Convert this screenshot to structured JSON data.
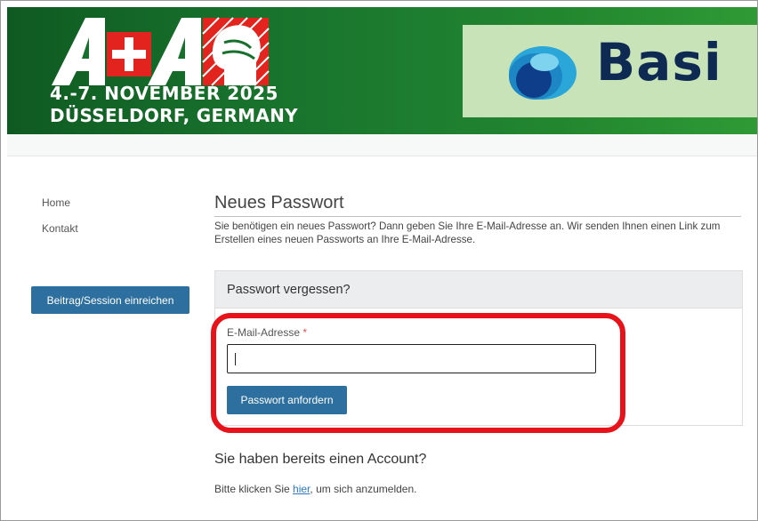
{
  "banner": {
    "logo_text": "A+A",
    "date": "4.-7. NOVEMBER 2025",
    "place": "DÜSSELDORF, GERMANY",
    "sponsor_name": "Basi"
  },
  "sidebar": {
    "items": [
      {
        "label": "Home"
      },
      {
        "label": "Kontakt"
      }
    ],
    "submit_button": "Beitrag/Session einreichen"
  },
  "main": {
    "title": "Neues Passwort",
    "intro": "Sie benötigen ein neues Passwort? Dann geben Sie Ihre E-Mail-Adresse an. Wir senden Ihnen einen Link zum Erstellen eines neuen Passworts an Ihre E-Mail-Adresse.",
    "panel": {
      "title": "Passwort vergessen?",
      "email_label": "E-Mail-Adresse",
      "required_marker": "*",
      "email_value": "",
      "button": "Passwort anfordern"
    },
    "account_title": "Sie haben bereits einen Account?",
    "login_prefix": "Bitte klicken Sie ",
    "login_link": "hier",
    "login_suffix": ", um sich anzumelden."
  },
  "colors": {
    "banner_green": "#1d7d30",
    "button_blue": "#2d6f9e",
    "highlight_red": "#e8121a",
    "sponsor_bg": "#c9e3b9",
    "link_blue": "#2a79c7"
  }
}
